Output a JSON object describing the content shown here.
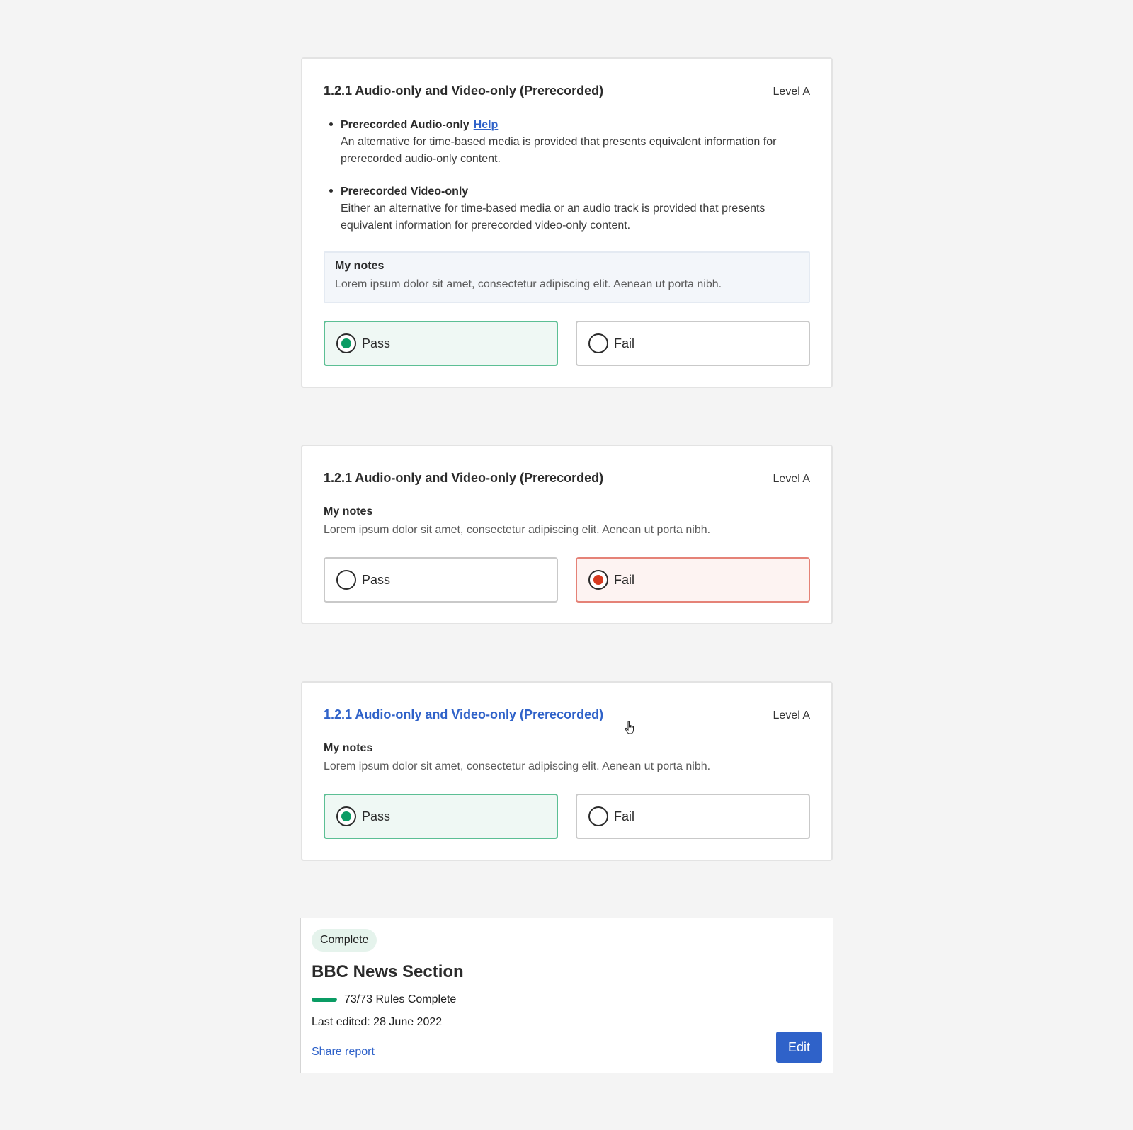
{
  "colors": {
    "accent": "#2f62c9",
    "pass_border": "#5cbf94",
    "pass_bg": "#eff8f4",
    "pass_dot": "#0a9c64",
    "fail_border": "#e58277",
    "fail_bg": "#fdf3f2",
    "fail_dot": "#d63a20"
  },
  "cards": [
    {
      "title": "1.2.1 Audio-only and Video-only (Prerecorded)",
      "level": "Level A",
      "bullets": [
        {
          "title": "Prerecorded Audio-only",
          "help_label": "Help",
          "line1": "An alternative for time-based media is provided that presents equivalent information for",
          "line2": "prerecorded audio-only content."
        },
        {
          "title": "Prerecorded Video-only",
          "line1": "Either an alternative for time-based media or an audio track is provided that presents",
          "line2": "equivalent information for prerecorded video-only content."
        }
      ],
      "notes_title": "My notes",
      "notes_text": "Lorem ipsum dolor sit amet, consectetur adipiscing elit. Aenean ut porta nibh.",
      "pass_label": "Pass",
      "fail_label": "Fail",
      "selected": "Pass"
    },
    {
      "title": "1.2.1 Audio-only and Video-only (Prerecorded)",
      "level": "Level A",
      "notes_title": "My notes",
      "notes_text": "Lorem ipsum dolor sit amet, consectetur adipiscing elit. Aenean ut porta nibh.",
      "pass_label": "Pass",
      "fail_label": "Fail",
      "selected": "Fail"
    },
    {
      "title": "1.2.1 Audio-only and Video-only (Prerecorded)",
      "level": "Level A",
      "notes_title": "My notes",
      "notes_text": "Lorem ipsum dolor sit amet, consectetur adipiscing elit. Aenean ut porta nibh.",
      "pass_label": "Pass",
      "fail_label": "Fail",
      "selected": "Pass",
      "title_hovered": true
    }
  ],
  "summary": {
    "badge": "Complete",
    "title": "BBC News Section",
    "progress_fraction": 1.0,
    "progress_text": "73/73 Rules Complete",
    "last_edited": "Last edited: 28 June 2022",
    "share_label": "Share report",
    "edit_label": "Edit"
  }
}
